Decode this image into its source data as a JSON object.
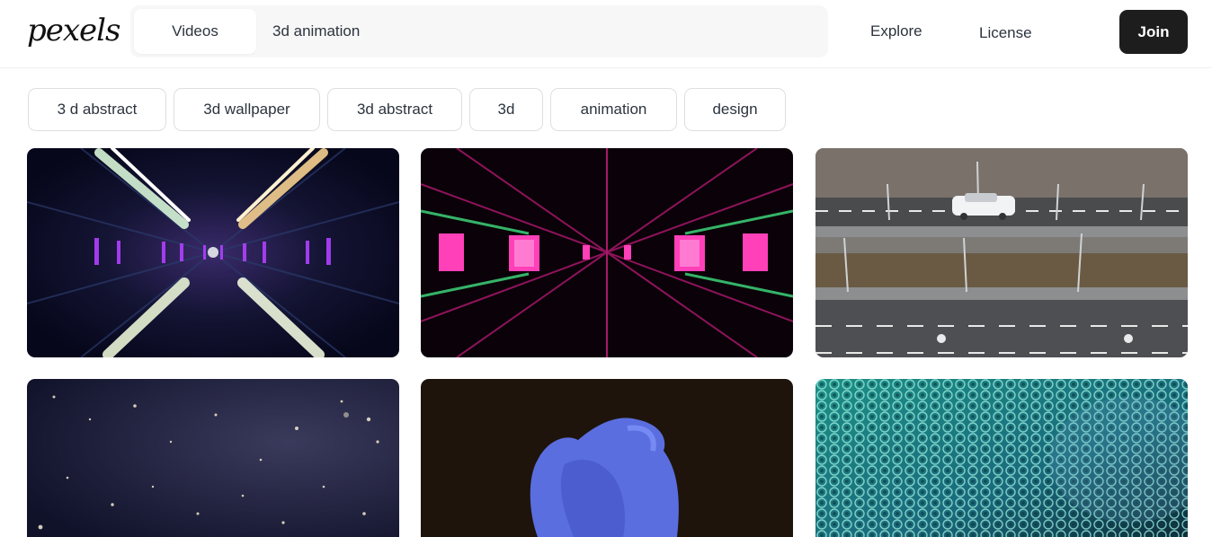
{
  "header": {
    "logo_text": "pexels",
    "media_type_tab": "Videos",
    "search_value": "3d animation",
    "nav": [
      "Explore",
      "License"
    ],
    "join_label": "Join"
  },
  "related_searches": [
    "3 d abstract",
    "3d wallpaper",
    "3d abstract",
    "3d",
    "animation",
    "design"
  ],
  "videos": [
    {
      "subject": "neon sci-fi tunnel with bright light beams"
    },
    {
      "subject": "pink neon geometric corridor"
    },
    {
      "subject": "aerial view of white car on highway"
    },
    {
      "subject": "starry particle space field"
    },
    {
      "subject": "blue melting 3d blob"
    },
    {
      "subject": "teal metallic sphere pattern wave"
    }
  ],
  "colors": {
    "join_bg": "#1d1d1d",
    "search_bg": "#f7f7f7",
    "chip_border": "#dfdfe0",
    "text": "#2c343e"
  }
}
